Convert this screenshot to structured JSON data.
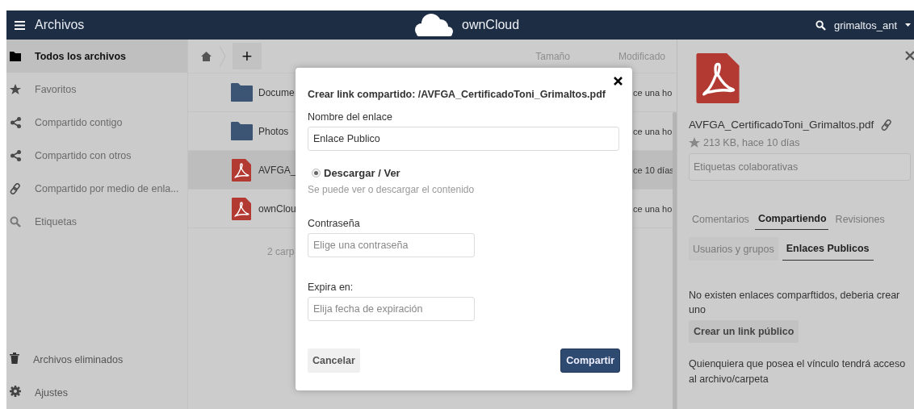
{
  "header": {
    "title": "Archivos",
    "logo_text": "ownCloud",
    "user": "grimaltos_ant"
  },
  "sidebar": {
    "items": [
      {
        "label": "Todos los archivos",
        "selected": true
      },
      {
        "label": "Favoritos",
        "selected": false
      },
      {
        "label": "Compartido contigo",
        "selected": false
      },
      {
        "label": "Compartido con otros",
        "selected": false
      },
      {
        "label": "Compartido por medio de enla...",
        "selected": false
      },
      {
        "label": "Etiquetas",
        "selected": false
      }
    ],
    "bottom_items": [
      {
        "label": "Archivos eliminados"
      },
      {
        "label": "Ajustes"
      }
    ]
  },
  "files": {
    "add_button": "+",
    "columns": [
      "Tamaño",
      "Modificado"
    ],
    "rows": [
      {
        "name": "Docume",
        "kind": "folder",
        "modified": "ce una ho",
        "selected": false
      },
      {
        "name": "Photos",
        "kind": "folder",
        "modified": "ce una ho",
        "selected": false
      },
      {
        "name": "AVFGA_",
        "kind": "pdf",
        "modified": "ce 10 días",
        "selected": true
      },
      {
        "name": "ownClou",
        "kind": "pdf",
        "modified": "ce una ho",
        "selected": false
      }
    ],
    "summary": "2 carp"
  },
  "panel": {
    "file_name": "AVFGA_CertificadoToni_Grimaltos.pdf",
    "meta": "213 KB, hace 10 días",
    "tags_placeholder": "Etiquetas colaborativas",
    "tabs": [
      {
        "label": "Comentarios",
        "selected": false
      },
      {
        "label": "Compartiendo",
        "selected": true
      },
      {
        "label": "Revisiones",
        "selected": false
      }
    ],
    "subtabs": [
      {
        "label": "Usuarios y grupos",
        "selected": false
      },
      {
        "label": "Enlaces Publicos",
        "selected": true
      }
    ],
    "empty_text": "No existen enlaces comparftidos, deberia crear uno",
    "create_button": "Crear un link público",
    "note": "Quienquiera que posea el vínculo tendrá acceso al archivo/carpeta"
  },
  "dialog": {
    "title": "Crear link compartido: /AVFGA_CertificadoToni_Grimaltos.pdf",
    "name_label": "Nombre del enlace",
    "name_value": "Enlace Publico",
    "permission": {
      "label": "Descargar / Ver",
      "selected": true
    },
    "permission_hint": "Se puede ver o descargar el contenido",
    "password_label": "Contraseña",
    "password_placeholder": "Elige una contraseña",
    "expire_label": "Expira en:",
    "expire_placeholder": "Elija fecha de expiración",
    "cancel": "Cancelar",
    "submit": "Compartir"
  }
}
